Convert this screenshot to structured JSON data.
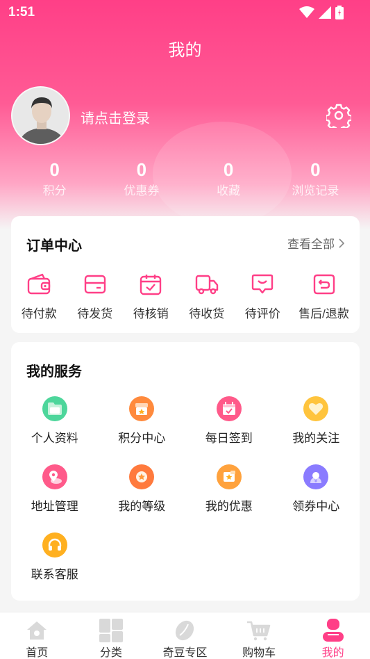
{
  "status_bar": {
    "time": "1:51"
  },
  "header": {
    "title": "我的",
    "login_prompt": "请点击登录"
  },
  "stats": [
    {
      "value": "0",
      "label": "积分"
    },
    {
      "value": "0",
      "label": "优惠券"
    },
    {
      "value": "0",
      "label": "收藏"
    },
    {
      "value": "0",
      "label": "浏览记录"
    }
  ],
  "orders": {
    "title": "订单中心",
    "view_all": "查看全部",
    "items": [
      {
        "label": "待付款",
        "icon": "wallet-icon"
      },
      {
        "label": "待发货",
        "icon": "card-icon"
      },
      {
        "label": "待核销",
        "icon": "calendar-check-icon"
      },
      {
        "label": "待收货",
        "icon": "truck-icon"
      },
      {
        "label": "待评价",
        "icon": "comment-icon"
      },
      {
        "label": "售后/退款",
        "icon": "return-icon"
      }
    ]
  },
  "services": {
    "title": "我的服务",
    "items": [
      {
        "label": "个人资料",
        "icon": "folder-icon",
        "color": "#4dd69b"
      },
      {
        "label": "积分中心",
        "icon": "shop-icon",
        "color": "#ff8a3d"
      },
      {
        "label": "每日签到",
        "icon": "calendar-icon",
        "color": "#ff5a8a"
      },
      {
        "label": "我的关注",
        "icon": "heart-icon",
        "color": "#ffc43d"
      },
      {
        "label": "地址管理",
        "icon": "location-icon",
        "color": "#ff5a8a"
      },
      {
        "label": "我的等级",
        "icon": "medal-icon",
        "color": "#ff7a3d"
      },
      {
        "label": "我的优惠",
        "icon": "coupon-icon",
        "color": "#ffa23d"
      },
      {
        "label": "领券中心",
        "icon": "yen-icon",
        "color": "#8a7bff"
      },
      {
        "label": "联系客服",
        "icon": "headset-icon",
        "color": "#ffb020"
      }
    ]
  },
  "tabbar": [
    {
      "label": "首页",
      "icon": "home-icon",
      "active": false
    },
    {
      "label": "分类",
      "icon": "grid-icon",
      "active": false
    },
    {
      "label": "奇豆专区",
      "icon": "bean-icon",
      "active": false
    },
    {
      "label": "购物车",
      "icon": "cart-icon",
      "active": false
    },
    {
      "label": "我的",
      "icon": "user-icon",
      "active": true
    }
  ],
  "colors": {
    "accent": "#ff3f87",
    "accent_light": "#ffa6c5"
  }
}
